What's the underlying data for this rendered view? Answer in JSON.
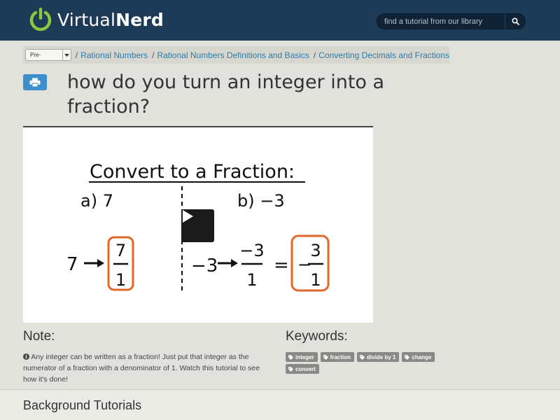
{
  "header": {
    "brand_regular": "Virtual",
    "brand_bold": "Nerd",
    "search_placeholder": "find a tutorial from our library"
  },
  "breadcrumb": {
    "subject": "Pre-Algebra",
    "items": [
      "Rational Numbers",
      "Rational Numbers Definitions and Basics",
      "Converting Decimals and Fractions"
    ]
  },
  "page": {
    "title": "how do you turn an integer into a fraction?"
  },
  "video": {
    "heading": "Convert to a Fraction:",
    "part_a": "a) 7",
    "part_b": "b) −3",
    "a_integer": "7",
    "a_numerator": "7",
    "a_denominator": "1",
    "b_integer": "−3",
    "b_numerator": "−3",
    "b_denominator": "1",
    "equals": "=",
    "b_sign": "−",
    "b_result_numerator": "3",
    "b_result_denominator": "1"
  },
  "note": {
    "title": "Note:",
    "text": "Any integer can be written as a fraction! Just put that integer as the numerator of a fraction with a denominator of 1. Watch this tutorial to see how it's done!"
  },
  "keywords": {
    "title": "Keywords:",
    "tags": [
      "integer",
      "fraction",
      "divide by 1",
      "change",
      "convert"
    ]
  },
  "background": {
    "title": "Background Tutorials"
  },
  "colors": {
    "header_bg": "#1d3a57",
    "brand_green": "#8cc63f",
    "link_blue": "#2b7ba8",
    "highlight_orange": "#e2682a",
    "print_button": "#3b8fcb"
  }
}
